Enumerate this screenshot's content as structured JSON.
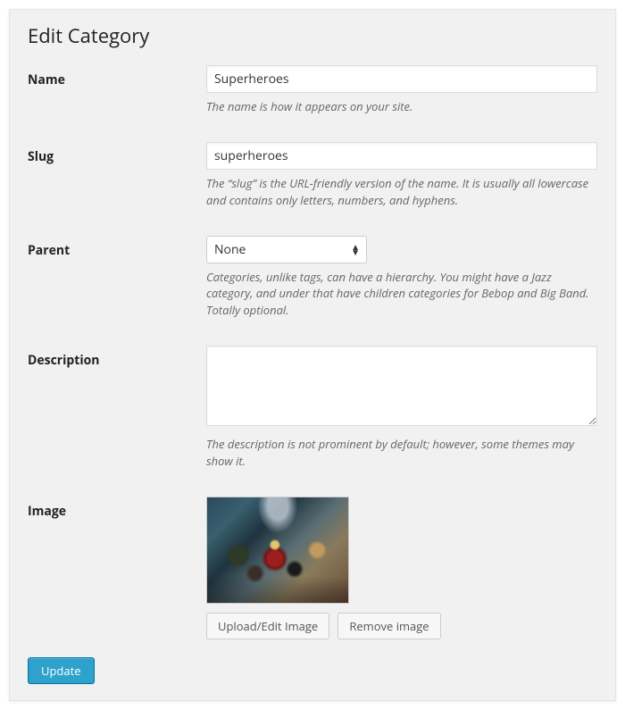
{
  "page": {
    "title": "Edit Category"
  },
  "fields": {
    "name": {
      "label": "Name",
      "value": "Superheroes",
      "help": "The name is how it appears on your site."
    },
    "slug": {
      "label": "Slug",
      "value": "superheroes",
      "help": "The “slug” is the URL-friendly version of the name. It is usually all lowercase and contains only letters, numbers, and hyphens."
    },
    "parent": {
      "label": "Parent",
      "selected": "None",
      "help": "Categories, unlike tags, can have a hierarchy. You might have a Jazz category, and under that have children categories for Bebop and Big Band. Totally optional."
    },
    "description": {
      "label": "Description",
      "value": "",
      "help": "The description is not prominent by default; however, some themes may show it."
    },
    "image": {
      "label": "Image",
      "upload_button": "Upload/Edit Image",
      "remove_button": "Remove image"
    }
  },
  "actions": {
    "submit": "Update"
  }
}
